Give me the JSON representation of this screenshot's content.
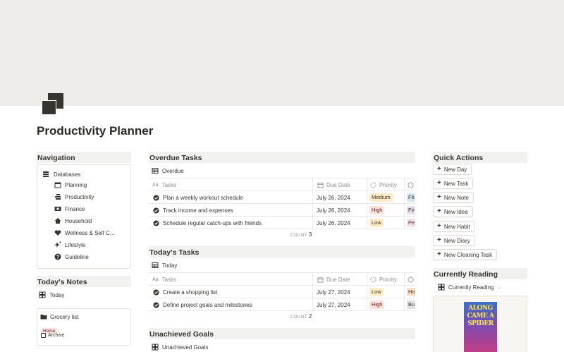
{
  "page": {
    "title": "Productivity Planner",
    "cover_color": "#eeede9",
    "icon": "stacked-squares-icon"
  },
  "navigation": {
    "heading": "Navigation",
    "databases_label": "Databases",
    "items": [
      {
        "label": "Planning",
        "icon": "calendar-icon"
      },
      {
        "label": "Productivity",
        "icon": "stack-icon"
      },
      {
        "label": "Finance",
        "icon": "money-icon"
      },
      {
        "label": "Household",
        "icon": "house-icon"
      },
      {
        "label": "Wellness & Self C...",
        "icon": "heart-icon"
      },
      {
        "label": "Lifestyle",
        "icon": "sparkles-icon"
      },
      {
        "label": "Guideline",
        "icon": "help-icon"
      }
    ]
  },
  "notes": {
    "heading": "Today's Notes",
    "view_label": "Today",
    "card": {
      "title": "Grocery list",
      "tag": "Home",
      "archive_label": "Archive"
    }
  },
  "columns": {
    "tasks": "Tasks",
    "due_date": "Due Date",
    "priority": "Priority"
  },
  "overdue": {
    "heading": "Overdue Tasks",
    "view_label": "Overdue",
    "count_label": "COUNT",
    "count": "3",
    "rows": [
      {
        "task": "Plan a weekly workout schedule",
        "due": "July 26, 2024",
        "priority": "Medium",
        "priority_class": "p-medium",
        "category": "Fit",
        "category_bg": "#d3e5ef"
      },
      {
        "task": "Track income and expenses",
        "due": "July 26, 2024",
        "priority": "High",
        "priority_class": "p-high",
        "category": "Fir",
        "category_bg": "#e8deee"
      },
      {
        "task": "Schedule regular catch-ups with friends",
        "due": "July 26, 2024",
        "priority": "Low",
        "priority_class": "p-low",
        "category": "Pe",
        "category_bg": "#f5e0e9"
      }
    ]
  },
  "today_tasks": {
    "heading": "Today's Tasks",
    "view_label": "Today",
    "count_label": "COUNT",
    "count": "2",
    "rows": [
      {
        "task": "Create a shopping list",
        "due": "July 27, 2024",
        "priority": "Low",
        "priority_class": "p-low",
        "category": "Ho",
        "category_bg": "#fadec9"
      },
      {
        "task": "Define project goals and milestones",
        "due": "July 27, 2024",
        "priority": "High",
        "priority_class": "p-high",
        "category": "Bu",
        "category_bg": "#e3e2e0"
      }
    ]
  },
  "unachieved": {
    "heading": "Unachieved Goals",
    "view_label": "Unachieved Goals"
  },
  "quick_actions": {
    "heading": "Quick Actions",
    "buttons": [
      "New Day",
      "New Task",
      "New Note",
      "New Idea",
      "New Habit",
      "New Diary",
      "New Cleaning Task"
    ]
  },
  "reading": {
    "heading": "Currently Reading",
    "view_label": "Currently Reading",
    "book_cover_lines": [
      "ALONG",
      "CAME A",
      "SPIDER"
    ]
  }
}
